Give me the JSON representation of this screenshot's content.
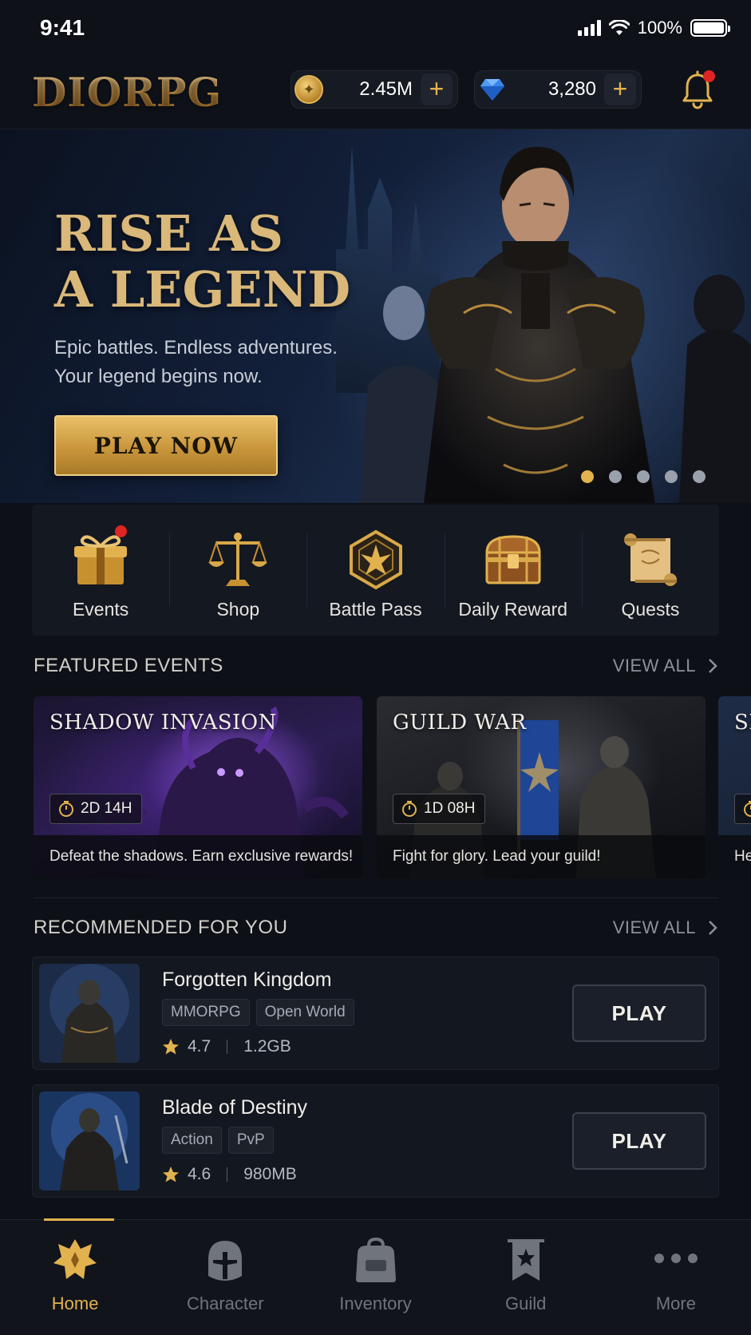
{
  "status_bar": {
    "time": "9:41",
    "battery": "100%",
    "icons": [
      "signal-icon",
      "wifi-icon",
      "battery-icon"
    ]
  },
  "header": {
    "logo": "DIORPG",
    "coins": "2.45M",
    "gems": "3,280",
    "icons": [
      "coin-icon",
      "gem-icon",
      "plus-icon",
      "bell-icon"
    ],
    "notification_dot": true
  },
  "hero": {
    "title": "RISE AS\nA LEGEND",
    "subtitle": "Epic battles. Endless adventures.\nYour legend begins now.",
    "cta": "PLAY NOW",
    "slide_count": 5,
    "active_slide": 1
  },
  "quick_menu": [
    {
      "label": "Events",
      "icon": "gift-icon",
      "badge": true
    },
    {
      "label": "Shop",
      "icon": "scales-icon",
      "badge": false
    },
    {
      "label": "Battle Pass",
      "icon": "crest-icon",
      "badge": false
    },
    {
      "label": "Daily Reward",
      "icon": "treasure-chest-icon",
      "badge": false
    },
    {
      "label": "Quests",
      "icon": "scroll-icon",
      "badge": false
    }
  ],
  "featured": {
    "title": "FEATURED EVENTS",
    "view_all": "VIEW ALL",
    "events": [
      {
        "title": "SHADOW INVASION",
        "timer": "2D 14H",
        "description": "Defeat the shadows. Earn exclusive rewards!"
      },
      {
        "title": "GUILD WAR",
        "timer": "1D 08H",
        "description": "Fight for glory. Lead your guild!"
      },
      {
        "title": "SI",
        "timer": "",
        "description": "He"
      }
    ]
  },
  "recommended": {
    "title": "RECOMMENDED FOR YOU",
    "view_all": "VIEW ALL",
    "games": [
      {
        "name": "Forgotten Kingdom",
        "tags": [
          "MMORPG",
          "Open World"
        ],
        "rating": "4.7",
        "size": "1.2GB",
        "button": "PLAY"
      },
      {
        "name": "Blade of Destiny",
        "tags": [
          "Action",
          "PvP"
        ],
        "rating": "4.6",
        "size": "980MB",
        "button": "PLAY"
      }
    ]
  },
  "nav": {
    "items": [
      {
        "label": "Home",
        "icon": "home-crest-icon",
        "active": true
      },
      {
        "label": "Character",
        "icon": "helmet-icon",
        "active": false
      },
      {
        "label": "Inventory",
        "icon": "backpack-icon",
        "active": false
      },
      {
        "label": "Guild",
        "icon": "banner-icon",
        "active": false
      },
      {
        "label": "More",
        "icon": "more-dots-icon",
        "active": false
      }
    ]
  },
  "colors": {
    "background": "#0d1016",
    "accent_gold": "#e2b24f",
    "notification_red": "#e02424"
  }
}
